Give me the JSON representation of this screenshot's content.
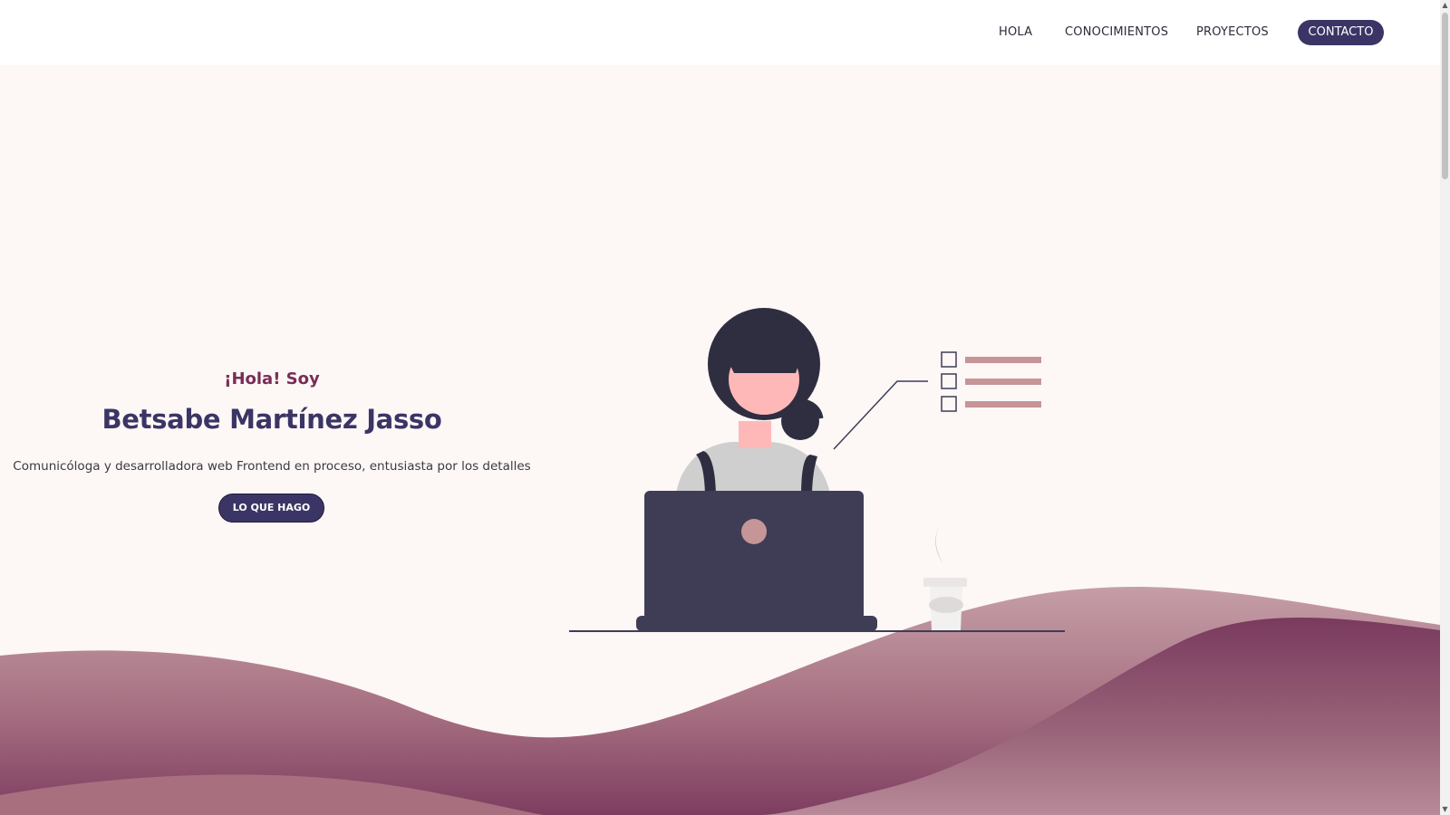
{
  "nav": {
    "items": [
      {
        "label": "HOLA"
      },
      {
        "label": "CONOCIMIENTOS"
      },
      {
        "label": "PROYECTOS"
      }
    ],
    "contact_label": "CONTACTO"
  },
  "hero": {
    "greeting": "¡Hola! Soy",
    "name": "Betsabe Martínez Jasso",
    "description": "Comunicóloga y desarrolladora web Frontend en proceso, entusiasta por los detalles",
    "button_label": "LO QUE HAGO"
  },
  "colors": {
    "primary": "#3b3566",
    "accent": "#7a2d56",
    "background": "#fdf7f6",
    "wave_light": "#b98a95",
    "wave_dark": "#7a3a5e"
  },
  "icons": {
    "scroll_up": "triangle-up",
    "scroll_down": "triangle-down"
  }
}
